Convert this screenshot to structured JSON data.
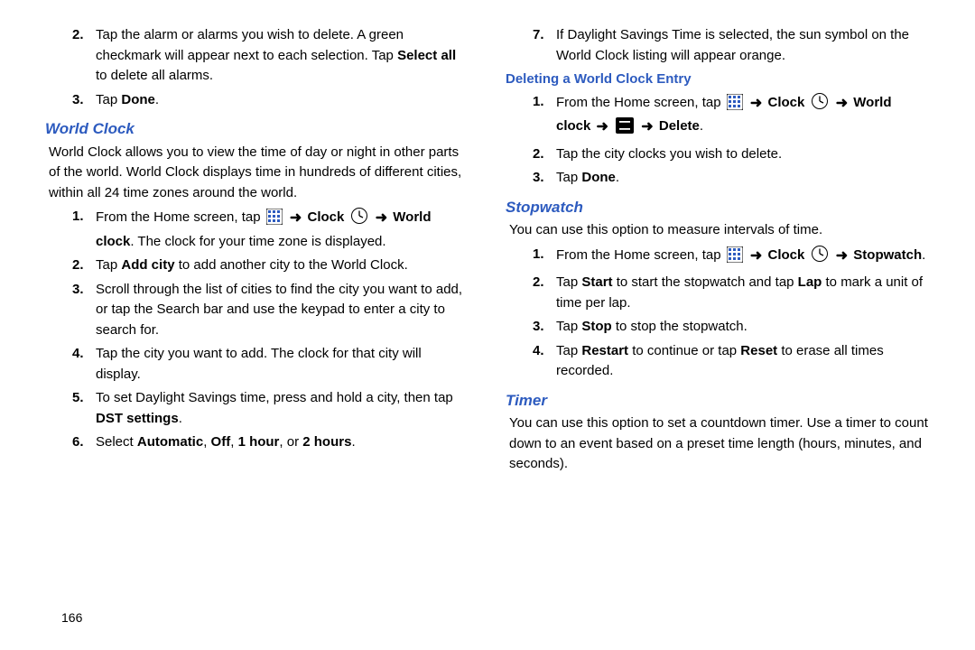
{
  "page_number": "166",
  "left": {
    "pre_steps": [
      {
        "num": "2.",
        "segs": [
          {
            "t": "Tap the alarm or alarms you wish to delete. A green checkmark will appear next to each selection. Tap "
          },
          {
            "t": "Select all",
            "b": true
          },
          {
            "t": " to delete all alarms."
          }
        ]
      },
      {
        "num": "3.",
        "segs": [
          {
            "t": "Tap "
          },
          {
            "t": "Done",
            "b": true
          },
          {
            "t": "."
          }
        ]
      }
    ],
    "heading": "World Clock",
    "intro": "World Clock allows you to view the time of day or night in other parts of the world. World Clock displays time in hundreds of different cities, within all 24 time zones around the world.",
    "steps": [
      {
        "num": "1.",
        "segs": [
          {
            "t": "From the Home screen, tap "
          },
          {
            "icon": "apps"
          },
          {
            "t": " "
          },
          {
            "icon": "arrow"
          },
          {
            "t": " "
          },
          {
            "t": "Clock",
            "b": true
          },
          {
            "t": " "
          },
          {
            "icon": "clock"
          },
          {
            "t": " "
          },
          {
            "icon": "arrow"
          },
          {
            "t": " "
          },
          {
            "t": "World clock",
            "b": true
          },
          {
            "t": ". The clock for your time zone is displayed."
          }
        ]
      },
      {
        "num": "2.",
        "segs": [
          {
            "t": "Tap "
          },
          {
            "t": "Add city",
            "b": true
          },
          {
            "t": " to add another city to the World Clock."
          }
        ]
      },
      {
        "num": "3.",
        "segs": [
          {
            "t": "Scroll through the list of cities to find the city you want to add, or tap the Search bar and use the keypad to enter a city to search for."
          }
        ]
      },
      {
        "num": "4.",
        "segs": [
          {
            "t": "Tap the city you want to add. The clock for that city will display."
          }
        ]
      },
      {
        "num": "5.",
        "segs": [
          {
            "t": "To set Daylight Savings time, press and hold a city, then tap "
          },
          {
            "t": "DST settings",
            "b": true
          },
          {
            "t": "."
          }
        ]
      },
      {
        "num": "6.",
        "segs": [
          {
            "t": "Select "
          },
          {
            "t": "Automatic",
            "b": true
          },
          {
            "t": ", "
          },
          {
            "t": "Off",
            "b": true
          },
          {
            "t": ", "
          },
          {
            "t": "1 hour",
            "b": true
          },
          {
            "t": ", or "
          },
          {
            "t": "2 hours",
            "b": true
          },
          {
            "t": "."
          }
        ]
      }
    ]
  },
  "right": {
    "pre_steps": [
      {
        "num": "7.",
        "segs": [
          {
            "t": "If Daylight Savings Time is selected, the sun symbol on the World Clock listing will appear orange."
          }
        ]
      }
    ],
    "sub1_heading": "Deleting a World Clock Entry",
    "sub1_steps": [
      {
        "num": "1.",
        "segs": [
          {
            "t": "From the Home screen, tap "
          },
          {
            "icon": "apps"
          },
          {
            "t": " "
          },
          {
            "icon": "arrow"
          },
          {
            "t": " "
          },
          {
            "t": "Clock",
            "b": true
          },
          {
            "t": " "
          },
          {
            "icon": "clock"
          },
          {
            "t": " "
          },
          {
            "icon": "arrow"
          },
          {
            "t": " "
          },
          {
            "t": "World clock",
            "b": true
          },
          {
            "t": " "
          },
          {
            "icon": "arrow"
          },
          {
            "t": " "
          },
          {
            "icon": "menu"
          },
          {
            "t": " "
          },
          {
            "icon": "arrow"
          },
          {
            "t": " "
          },
          {
            "t": "Delete",
            "b": true
          },
          {
            "t": "."
          }
        ]
      },
      {
        "num": "2.",
        "segs": [
          {
            "t": "Tap the city clocks you wish to delete."
          }
        ]
      },
      {
        "num": "3.",
        "segs": [
          {
            "t": "Tap "
          },
          {
            "t": "Done",
            "b": true
          },
          {
            "t": "."
          }
        ]
      }
    ],
    "heading2": "Stopwatch",
    "intro2": "You can use this option to measure intervals of time.",
    "steps2": [
      {
        "num": "1.",
        "segs": [
          {
            "t": "From the Home screen, tap "
          },
          {
            "icon": "apps"
          },
          {
            "t": " "
          },
          {
            "icon": "arrow"
          },
          {
            "t": " "
          },
          {
            "t": "Clock",
            "b": true
          },
          {
            "t": " "
          },
          {
            "icon": "clock"
          },
          {
            "t": " "
          },
          {
            "icon": "arrow"
          },
          {
            "t": " "
          },
          {
            "t": "Stopwatch",
            "b": true
          },
          {
            "t": "."
          }
        ]
      },
      {
        "num": "2.",
        "segs": [
          {
            "t": "Tap "
          },
          {
            "t": "Start",
            "b": true
          },
          {
            "t": " to start the stopwatch and tap "
          },
          {
            "t": "Lap",
            "b": true
          },
          {
            "t": " to mark a unit of time per lap."
          }
        ]
      },
      {
        "num": "3.",
        "segs": [
          {
            "t": "Tap "
          },
          {
            "t": "Stop",
            "b": true
          },
          {
            "t": " to stop the stopwatch."
          }
        ]
      },
      {
        "num": "4.",
        "segs": [
          {
            "t": "Tap "
          },
          {
            "t": "Restart",
            "b": true
          },
          {
            "t": " to continue or tap "
          },
          {
            "t": "Reset",
            "b": true
          },
          {
            "t": " to erase all times recorded."
          }
        ]
      }
    ],
    "heading3": "Timer",
    "intro3": "You can use this option to set a countdown timer. Use a timer to count down to an event based on a preset time length (hours, minutes, and seconds)."
  }
}
